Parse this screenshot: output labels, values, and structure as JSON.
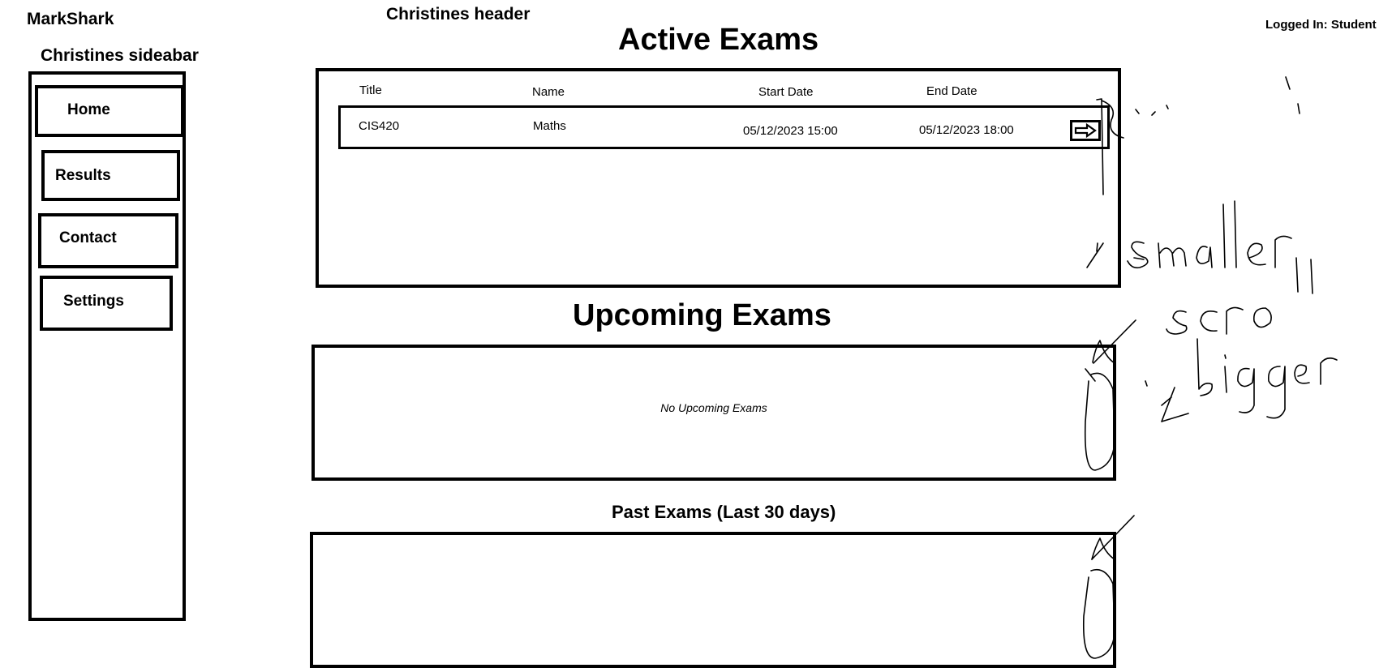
{
  "app": {
    "title": "MarkShark"
  },
  "header": {
    "note": "Christines header",
    "login_status": "Logged In: Student"
  },
  "sidebar": {
    "note": "Christines sideabar",
    "items": [
      {
        "label": "Home"
      },
      {
        "label": "Results"
      },
      {
        "label": "Contact"
      },
      {
        "label": "Settings"
      }
    ]
  },
  "active_exams": {
    "title": "Active Exams",
    "columns": [
      "Title",
      "Name",
      "Start Date",
      "End Date"
    ],
    "rows": [
      {
        "title": "CIS420",
        "name": "Maths",
        "start": "05/12/2023 15:00",
        "end": "05/12/2023 18:00"
      }
    ],
    "action_icon": "arrow-right-icon"
  },
  "upcoming_exams": {
    "title": "Upcoming Exams",
    "empty_text": "No Upcoming Exams"
  },
  "past_exams": {
    "title": "Past Exams (Last 30 days)"
  },
  "annotations": {
    "words": [
      "smaller",
      "scroll",
      "bigger"
    ]
  }
}
